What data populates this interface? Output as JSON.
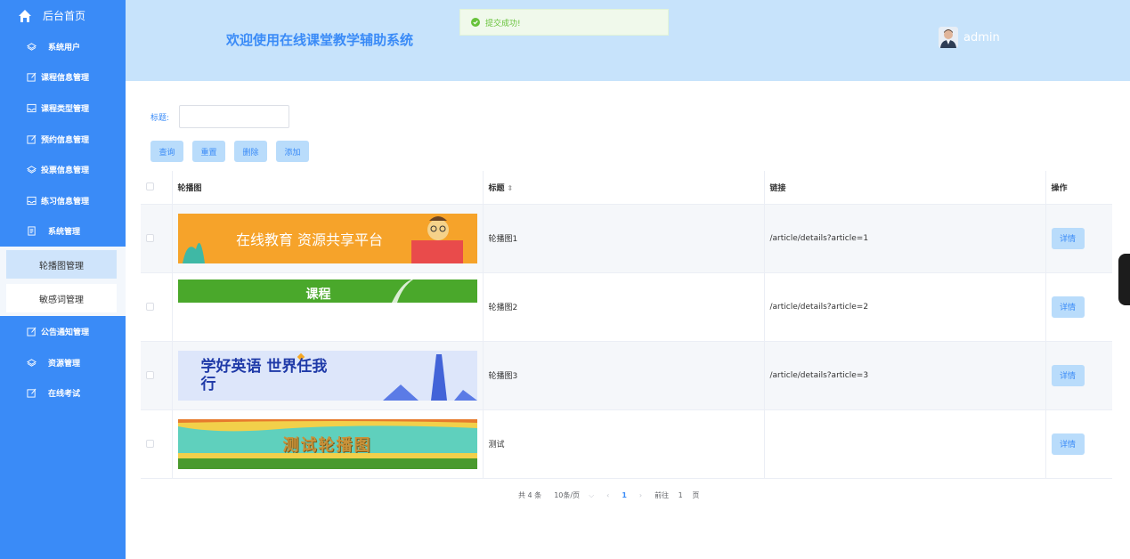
{
  "sidebar": {
    "home_label": "后台首页",
    "items": [
      {
        "label": "系统用户",
        "icon": "layers-icon"
      },
      {
        "label": "课程信息管理",
        "icon": "edit-icon"
      },
      {
        "label": "课程类型管理",
        "icon": "inbox-icon"
      },
      {
        "label": "预约信息管理",
        "icon": "edit-icon"
      },
      {
        "label": "投票信息管理",
        "icon": "layers-icon"
      },
      {
        "label": "练习信息管理",
        "icon": "inbox-icon"
      },
      {
        "label": "系统管理",
        "icon": "document-icon"
      }
    ],
    "submenu": [
      {
        "label": "轮播图管理",
        "active": true
      },
      {
        "label": "敏感词管理",
        "active": false
      }
    ],
    "items_after": [
      {
        "label": "公告通知管理",
        "icon": "edit-icon"
      },
      {
        "label": "资源管理",
        "icon": "layers-icon"
      },
      {
        "label": "在线考试",
        "icon": "edit-icon"
      }
    ]
  },
  "header": {
    "title": "欢迎使用在线课堂教学辅助系统",
    "toast": "提交成功!",
    "username": "admin"
  },
  "search": {
    "label": "标题:",
    "value": "",
    "placeholder": ""
  },
  "toolbar": {
    "query": "查询",
    "reset": "重置",
    "delete": "删除",
    "add": "添加"
  },
  "table": {
    "headers": {
      "image": "轮播图",
      "title": "标题",
      "link": "链接",
      "action": "操作"
    },
    "rows": [
      {
        "banner_text": "在线教育 资源共享平台",
        "title": "轮播图1",
        "link": "/article/details?article=1",
        "action": "详情"
      },
      {
        "banner_text": "课程",
        "title": "轮播图2",
        "link": "/article/details?article=2",
        "action": "详情"
      },
      {
        "banner_text": "学好英语 世界任我行",
        "title": "轮播图3",
        "link": "/article/details?article=3",
        "action": "详情"
      },
      {
        "banner_text": "测试轮播图",
        "title": "测试",
        "link": "",
        "action": "详情"
      }
    ]
  },
  "pagination": {
    "total": "共 4 条",
    "page_size": "10条/页",
    "current": "1",
    "goto_prefix": "前往",
    "goto_value": "1",
    "goto_suffix": "页"
  },
  "colors": {
    "sidebar_bg": "#3a8bf7",
    "header_bg": "#c7e3fb",
    "accent": "#3a8bf7",
    "success": "#67c23a"
  }
}
